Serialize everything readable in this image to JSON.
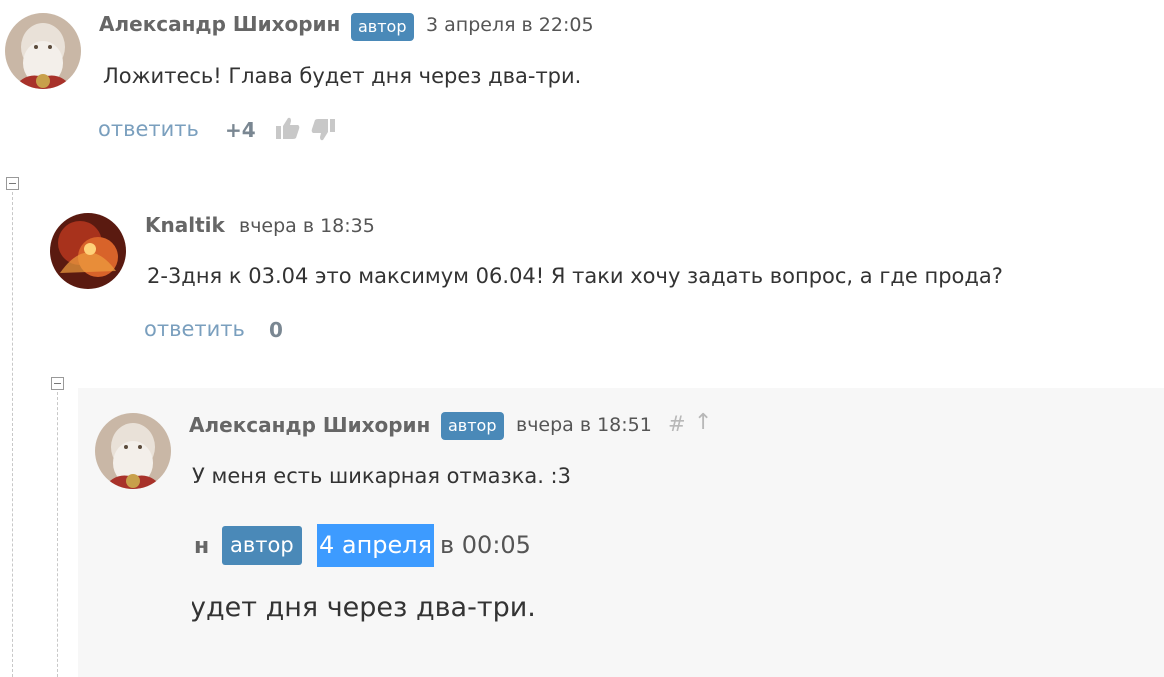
{
  "comments": [
    {
      "author": "Александр Шихорин",
      "badge": "автор",
      "date": "3 апреля в 22:05",
      "text": "Ложитесь! Глава будет дня через два-три.",
      "reply_label": "ответить",
      "score": "+4"
    },
    {
      "author": "Knaltik",
      "date": "вчера в 18:35",
      "text": "2-3дня к 03.04 это максимум 06.04! Я таки хочу задать вопрос, а где прода?",
      "reply_label": "ответить",
      "score": "0"
    },
    {
      "author": "Александр Шихорин",
      "badge": "автор",
      "date": "вчера в 18:51",
      "hash": "#",
      "up_arrow": "↑",
      "text": "У меня есть шикарная отмазка. :3",
      "quote": {
        "author_fragment": "н",
        "badge": "автор",
        "date_highlighted": "4 апреля",
        "date_rest": "в 00:05",
        "text_fragment": "удет дня через два-три."
      }
    }
  ],
  "icons": {
    "thumb_up": "thumb-up-icon",
    "thumb_down": "thumb-down-icon",
    "collapse": "collapse-icon"
  },
  "colors": {
    "badge": "#4a89b8",
    "reply_link": "#7a9fbe",
    "highlight": "#3d9bff"
  }
}
